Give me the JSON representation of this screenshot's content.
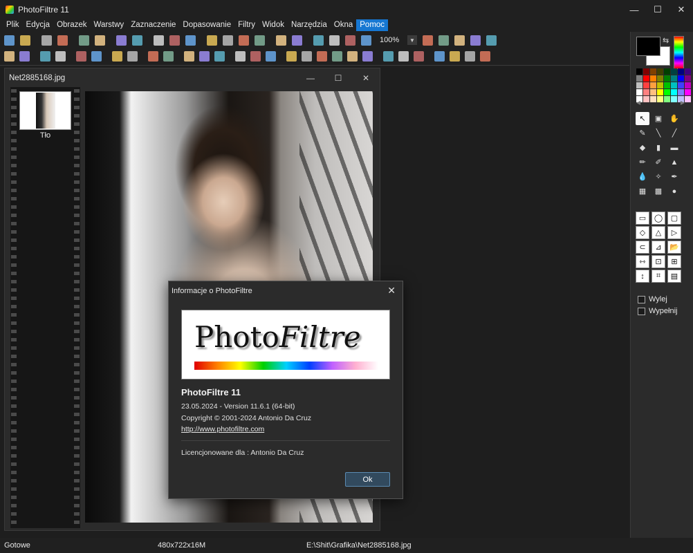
{
  "app": {
    "title": "PhotoFiltre 11"
  },
  "window_controls": {
    "minimize": "—",
    "maximize": "☐",
    "close": "✕"
  },
  "menu": [
    "Plik",
    "Edycja",
    "Obrazek",
    "Warstwy",
    "Zaznaczenie",
    "Dopasowanie",
    "Filtry",
    "Widok",
    "Narzędzia",
    "Okna",
    "Pomoc"
  ],
  "menu_active": "Pomoc",
  "toolbar": {
    "zoom_value": "100%",
    "row1_icons": [
      "new-icon",
      "open-icon",
      "save-icon",
      "save-all-icon",
      "print-icon",
      "scan-icon",
      "undo-icon",
      "redo-icon",
      "image-size-icon",
      "canvas-size-icon",
      "copy-icon",
      "grayscale-icon",
      "color-icon",
      "bold-b-icon",
      "autocrop-icon",
      "paste-layer-icon",
      "text-icon",
      "web-icon",
      "settings-icon",
      "transform-icon",
      "browser-icon"
    ],
    "row1_after_zoom": [
      "zoom-in-icon",
      "zoom-out-icon",
      "zoom-fit-icon",
      "picture-icon",
      "fullscreen-icon"
    ],
    "row2_icons": [
      "dot-icon",
      "dot-plus-icon",
      "pointer-icon",
      "pointer-plus-icon",
      "text-tool-icon",
      "text-plus-icon",
      "palette-icon",
      "palette-plus-icon",
      "levels-icon",
      "levels-plus-icon",
      "contrast-icon",
      "brightness-icon",
      "brightness-plus-icon",
      "grid-icon",
      "grid-alt-icon",
      "checker-icon",
      "frame-icon",
      "drop-icon",
      "drop-alt-icon",
      "mountain-icon",
      "drop-small-icon",
      "drop-outline-icon",
      "gradient-icon",
      "monitor-icon",
      "cross-icon",
      "mirror-h-icon",
      "flip-icon",
      "rotate-icon",
      "paste-icon"
    ]
  },
  "document": {
    "filename": "Net2885168.jpg",
    "layer_name": "Tło"
  },
  "right_panel": {
    "fg_color": "#000000",
    "bg_color": "#ffffff",
    "palette": [
      "#000000",
      "#800000",
      "#804000",
      "#404000",
      "#004000",
      "#004040",
      "#000080",
      "#400080",
      "#808080",
      "#ff0000",
      "#ff8000",
      "#808000",
      "#008000",
      "#008080",
      "#0000ff",
      "#800080",
      "#c0c0c0",
      "#ff4040",
      "#ffa040",
      "#c0c000",
      "#00c000",
      "#00c0c0",
      "#4040ff",
      "#c000c0",
      "#ffffff",
      "#ff8080",
      "#ffc080",
      "#ffff00",
      "#00ff00",
      "#00ffff",
      "#8080ff",
      "#ff00ff",
      "#ffffff",
      "#ffc0c0",
      "#ffe0c0",
      "#ffff80",
      "#80ff80",
      "#80ffff",
      "#c0c0ff",
      "#ffc0ff"
    ],
    "tools": [
      "arrow-icon",
      "magic-wand-icon",
      "hand-icon",
      "eyedropper-icon",
      "line-icon",
      "line-alt-icon",
      "bucket-icon",
      "spray-icon",
      "eraser-icon",
      "pencil-icon",
      "brush-icon",
      "stamp-icon",
      "drop-tool-icon",
      "smudge-icon",
      "pen-icon",
      "pattern-icon",
      "portrait-icon",
      "strawberry-icon"
    ],
    "tool_glyphs": [
      "↖",
      "▣",
      "✋",
      "✎",
      "╲",
      "╱",
      "◆",
      "▮",
      "▬",
      "✏",
      "✐",
      "▲",
      "💧",
      "✧",
      "✒",
      "▦",
      "▩",
      "●"
    ],
    "shapes": [
      "rect-select-icon",
      "ellipse-select-icon",
      "rounded-rect-select-icon",
      "diamond-select-icon",
      "triangle-select-icon",
      "play-select-icon",
      "lasso-icon",
      "polygon-lasso-icon",
      "open-selection-icon",
      "fit-horizontal-icon",
      "fit-selection-icon",
      "fit-both-icon",
      "fit-vertical-icon",
      "crop-icon",
      "window-icon"
    ],
    "shape_glyphs": [
      "▭",
      "◯",
      "▢",
      "◇",
      "△",
      "▷",
      "⊂",
      "⊿",
      "📂",
      "⇿",
      "⊡",
      "⊞",
      "↕",
      "⌗",
      "▤"
    ],
    "checkboxes": [
      {
        "label": "Wylej",
        "checked": false
      },
      {
        "label": "Wypełnij",
        "checked": false
      }
    ]
  },
  "dialog": {
    "title": "Informacje o PhotoFiltre",
    "close": "✕",
    "logo_text_a": "Photo",
    "logo_text_b": "Filtre",
    "app_name": "PhotoFiltre 11",
    "version_line": "23.05.2024 - Version 11.6.1 (64-bit)",
    "copyright": "Copyright © 2001-2024  Antonio Da Cruz",
    "url": "http://www.photofiltre.com",
    "license": "Licencjonowane dla : Antonio Da Cruz",
    "ok_label": "Ok"
  },
  "status": {
    "state": "Gotowe",
    "dimensions": "480x722x16M",
    "path": "E:\\Shit\\Grafika\\Net2885168.jpg"
  }
}
